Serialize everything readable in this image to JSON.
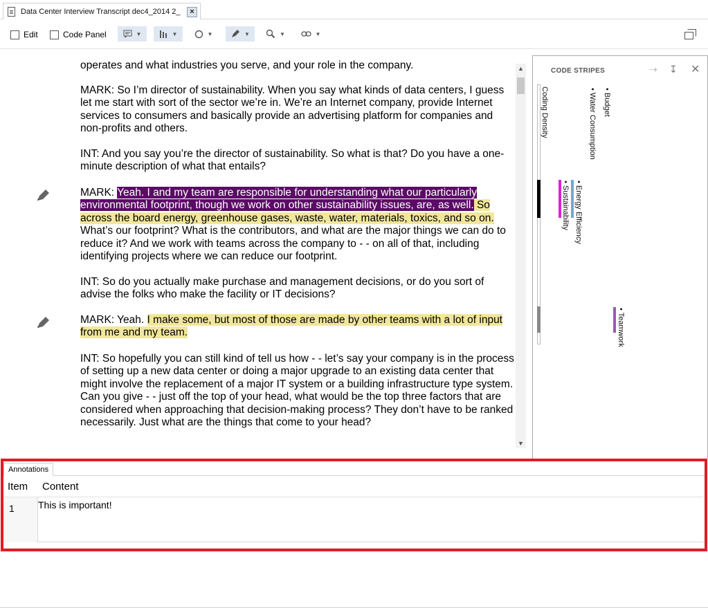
{
  "tab": {
    "title": "Data Center Interview Transcript dec4_2014 2_",
    "close": "×"
  },
  "toolbar": {
    "edit_label": "Edit",
    "code_panel_label": "Code Panel"
  },
  "document": {
    "paragraphs": {
      "p0": "operates and what industries you serve, and your role in the company.",
      "p1": "MARK:  So I’m director of sustainability.  When you say what kinds of data centers, I guess let me start with sort of the sector we’re in.  We’re an Internet company, provide Internet services to consumers and basically provide an advertising platform for companies and non-profits and others.",
      "p2": "INT:  And you say you’re the director of sustainability.  So what is that?  Do you have a one-minute description of what that entails?",
      "p3_a": "MARK:  ",
      "p3_b": "Yeah.  I and my team are responsible for understanding what our particularly environmental footprint, though we work on other sustainability issues, are, as well.",
      "p3_c": "  So across the board energy, greenhouse gases, waste, water, materials, toxics, and so on.",
      "p3_d": "  What’s our footprint?  What is the contributors, and what are the major things we can do to reduce it?  And we work with teams across the company to - - on all of that, including identifying projects where we can reduce our footprint.",
      "p4": "INT:  So do you actually make purchase and management decisions, or do you sort of advise the folks who make the facility or IT decisions?",
      "p5_a": "MARK:  Yeah.  ",
      "p5_b": "I make some, but most of those are made by other teams with a lot of input from me and my team.",
      "p6": "INT:  So hopefully you can still kind of tell us how - - let’s say your company is in the process of setting up a new data center or doing a major upgrade to an existing data center that might involve the replacement of a major IT system or a building infrastructure type system.  Can you give - - just off the top of your head, what would be the top three factors that are considered when approaching that decision-making process?  They don’t have to be ranked necessarily.  Just what are the things that come to your head?"
    },
    "highlight_colors": {
      "purple": "#5b0a66",
      "yellow": "#f1e69c"
    }
  },
  "code_stripes": {
    "title": "CODE STRIPES",
    "coding_density": "Coding Density",
    "codes": {
      "budget": "• Budget",
      "water": "• Water Consumption",
      "energy": "• Energy Efficiency",
      "sustainability": "• Sustainability",
      "teamwork": "• Teamwork"
    },
    "colors": {
      "sustainability": "#e020d8",
      "energy": "#6fa8dc",
      "teamwork": "#9b59b6"
    }
  },
  "annotations": {
    "tab_label": "Annotations",
    "col_item": "Item",
    "col_content": "Content",
    "rows": [
      {
        "item": "1",
        "content": "This is important!"
      }
    ]
  }
}
